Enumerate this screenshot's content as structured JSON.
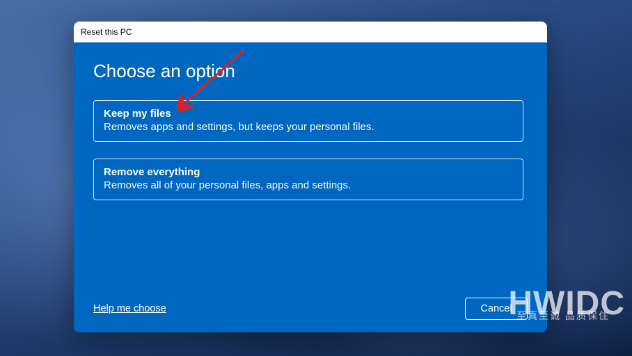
{
  "dialog": {
    "title": "Reset this PC",
    "heading": "Choose an option",
    "options": [
      {
        "title": "Keep my files",
        "desc": "Removes apps and settings, but keeps your personal files."
      },
      {
        "title": "Remove everything",
        "desc": "Removes all of your personal files, apps and settings."
      }
    ],
    "help_link": "Help me choose",
    "cancel": "Cancel"
  },
  "watermark": {
    "main": "HWIDC",
    "sub": "至真至诚 品质保住"
  }
}
